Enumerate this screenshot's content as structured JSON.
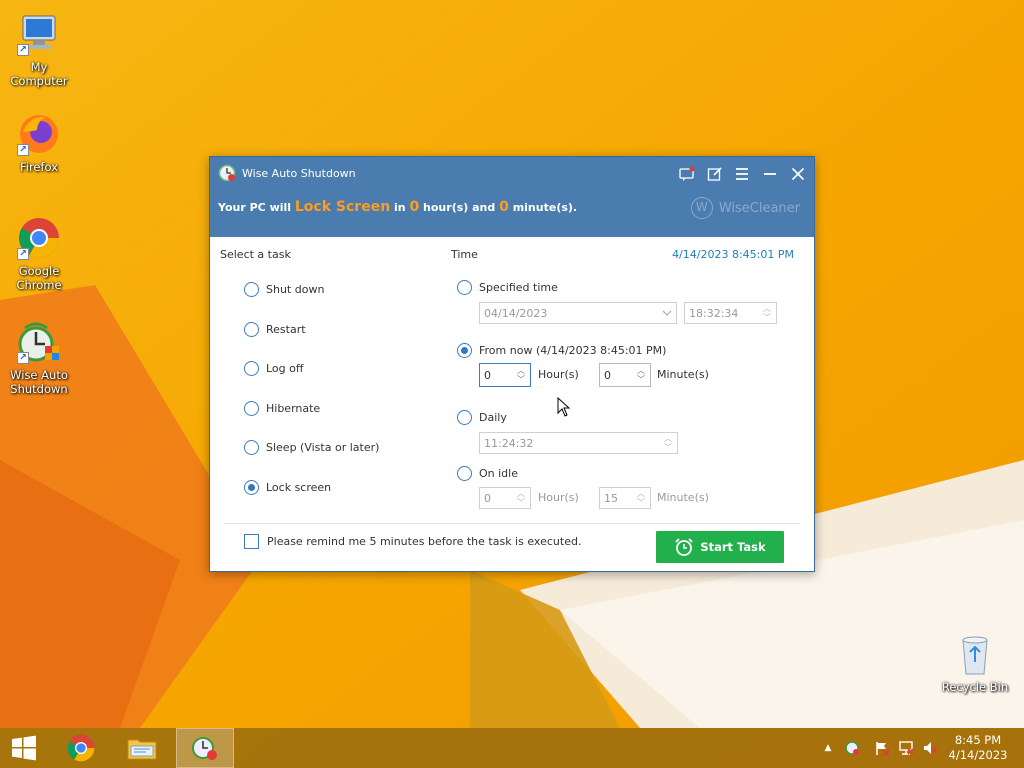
{
  "desktop": {
    "icons": [
      {
        "label": "My Computer"
      },
      {
        "label": "Firefox"
      },
      {
        "label": "Google Chrome"
      },
      {
        "label": "Wise Auto Shutdown"
      },
      {
        "label": "Recycle Bin"
      }
    ]
  },
  "window": {
    "title": "Wise Auto Shutdown",
    "status": {
      "prefix": "Your PC will",
      "action": "Lock Screen",
      "in": "in",
      "hours": "0",
      "hours_suffix": "hour(s) and",
      "minutes": "0",
      "minutes_suffix": "minute(s)."
    },
    "brand": "WiseCleaner",
    "brand_logo_letter": "W",
    "task_section_label": "Select a task",
    "time_section_label": "Time",
    "clock_readout": "4/14/2023 8:45:01 PM",
    "tasks": [
      {
        "label": "Shut down",
        "checked": false
      },
      {
        "label": "Restart",
        "checked": false
      },
      {
        "label": "Log off",
        "checked": false
      },
      {
        "label": "Hibernate",
        "checked": false
      },
      {
        "label": "Sleep (Vista or later)",
        "checked": false
      },
      {
        "label": "Lock screen",
        "checked": true
      }
    ],
    "time_options": {
      "specified": {
        "label": "Specified time",
        "checked": false,
        "date": "04/14/2023",
        "time": "18:32:34"
      },
      "from_now": {
        "label": "From now (4/14/2023 8:45:01 PM)",
        "checked": true,
        "hours": "0",
        "hours_label": "Hour(s)",
        "minutes": "0",
        "minutes_label": "Minute(s)"
      },
      "daily": {
        "label": "Daily",
        "checked": false,
        "time": "11:24:32"
      },
      "on_idle": {
        "label": "On idle",
        "checked": false,
        "hours": "0",
        "hours_label": "Hour(s)",
        "minutes": "15",
        "minutes_label": "Minute(s)"
      }
    },
    "remind_label": "Please remind me 5 minutes before the task is executed.",
    "remind_checked": false,
    "start_button": "Start Task"
  },
  "taskbar": {
    "clock_time": "8:45 PM",
    "clock_date": "4/14/2023"
  },
  "colors": {
    "titlebar": "#4a7cb0",
    "accent_orange": "#ff9d1f",
    "start_green": "#21b04b",
    "radio_blue": "#2f78c4",
    "wallpaper": "#f6a800"
  }
}
